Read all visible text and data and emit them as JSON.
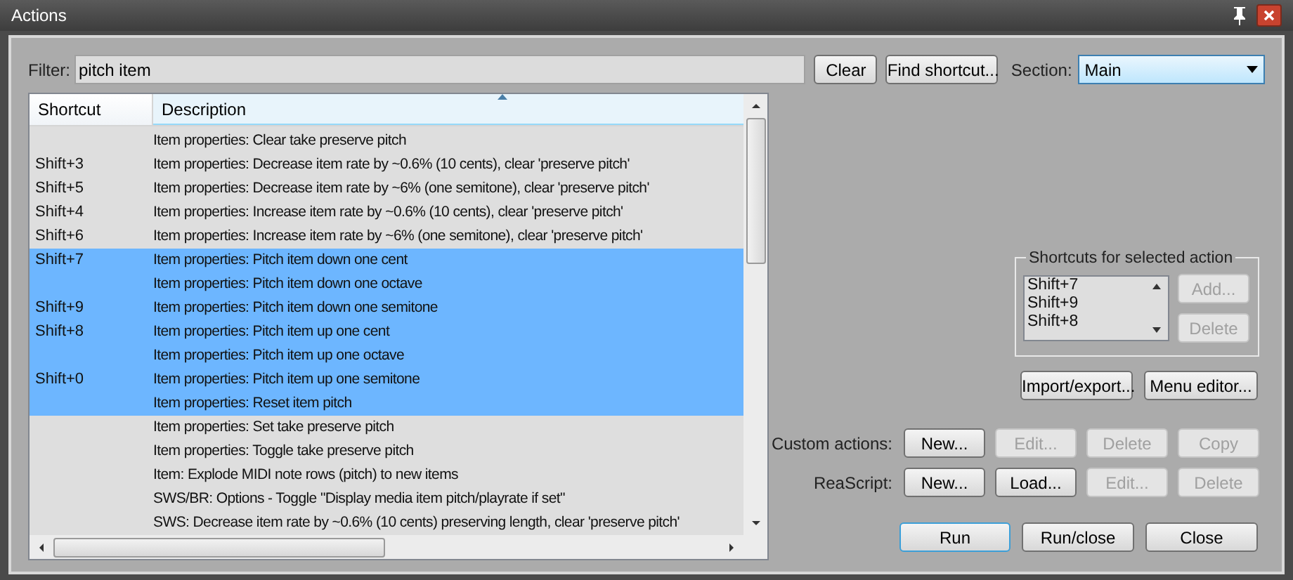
{
  "window": {
    "title": "Actions"
  },
  "filter": {
    "label": "Filter:",
    "value": "pitch item"
  },
  "filter_buttons": [
    {
      "label": "Clear"
    },
    {
      "label": "Find shortcut..."
    }
  ],
  "section": {
    "label": "Section:",
    "value": "Main"
  },
  "table": {
    "columns": [
      "Shortcut",
      "Description"
    ],
    "rows": [
      {
        "description": "Item properties: Clear take preserve pitch",
        "selected": false
      },
      {
        "shortcut": "Shift+3",
        "description": "Item properties: Decrease item rate by ~0.6% (10 cents), clear 'preserve pitch'",
        "selected": false
      },
      {
        "shortcut": "Shift+5",
        "description": "Item properties: Decrease item rate by ~6% (one semitone), clear 'preserve pitch'",
        "selected": false
      },
      {
        "shortcut": "Shift+4",
        "description": "Item properties: Increase item rate by ~0.6% (10 cents), clear 'preserve pitch'",
        "selected": false
      },
      {
        "shortcut": "Shift+6",
        "description": "Item properties: Increase item rate by ~6% (one semitone), clear 'preserve pitch'",
        "selected": false
      },
      {
        "shortcut": "Shift+7",
        "description": "Item properties: Pitch item down one cent",
        "selected": true
      },
      {
        "description": "Item properties: Pitch item down one octave",
        "selected": true
      },
      {
        "shortcut": "Shift+9",
        "description": "Item properties: Pitch item down one semitone",
        "selected": true
      },
      {
        "shortcut": "Shift+8",
        "description": "Item properties: Pitch item up one cent",
        "selected": true
      },
      {
        "description": "Item properties: Pitch item up one octave",
        "selected": true
      },
      {
        "shortcut": "Shift+0",
        "description": "Item properties: Pitch item up one semitone",
        "selected": true
      },
      {
        "description": "Item properties: Reset item pitch",
        "selected": true
      },
      {
        "description": "Item properties: Set take preserve pitch",
        "selected": false
      },
      {
        "description": "Item properties: Toggle take preserve pitch",
        "selected": false
      },
      {
        "description": "Item: Explode MIDI note rows (pitch) to new items",
        "selected": false
      },
      {
        "description": "SWS/BR: Options - Toggle \"Display media item pitch/playrate if set\"",
        "selected": false
      },
      {
        "description": "SWS: Decrease item rate by ~0.6% (10 cents) preserving length, clear 'preserve pitch'",
        "selected": false
      }
    ]
  },
  "shortcuts_group": {
    "title": "Shortcuts for selected action",
    "items": [
      "Shift+7",
      "Shift+9",
      "Shift+8"
    ],
    "buttons": [
      {
        "label": "Add...",
        "disabled": true
      },
      {
        "label": "Delete",
        "disabled": true
      }
    ]
  },
  "tool_buttons": [
    {
      "label": "Import/export..."
    },
    {
      "label": "Menu editor..."
    }
  ],
  "button_rows": [
    {
      "label": "Custom actions:",
      "buttons": [
        {
          "label": "New...",
          "disabled": false
        },
        {
          "label": "Edit...",
          "disabled": true
        },
        {
          "label": "Delete",
          "disabled": true
        },
        {
          "label": "Copy",
          "disabled": true
        }
      ]
    },
    {
      "label": "ReaScript:",
      "buttons": [
        {
          "label": "New...",
          "disabled": false
        },
        {
          "label": "Load...",
          "disabled": false
        },
        {
          "label": "Edit...",
          "disabled": true
        },
        {
          "label": "Delete",
          "disabled": true
        }
      ]
    }
  ],
  "footer_buttons": [
    {
      "label": "Run",
      "default": true
    },
    {
      "label": "Run/close",
      "default": false
    },
    {
      "label": "Close",
      "default": false
    }
  ]
}
